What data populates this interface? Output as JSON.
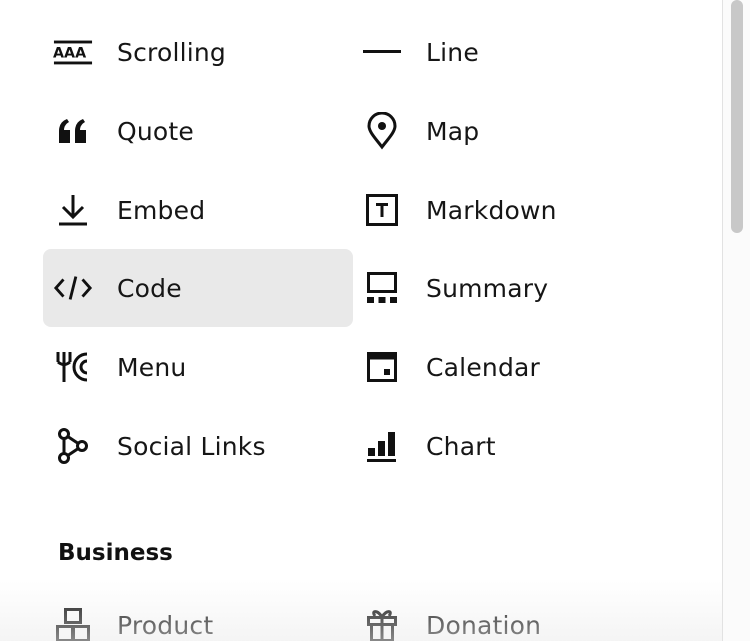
{
  "blocks": {
    "left": [
      {
        "label": "Scrolling",
        "icon": "scrolling-text-icon"
      },
      {
        "label": "Quote",
        "icon": "quote-icon"
      },
      {
        "label": "Embed",
        "icon": "embed-download-icon"
      },
      {
        "label": "Code",
        "icon": "code-icon",
        "selected": true
      },
      {
        "label": "Menu",
        "icon": "menu-fork-icon"
      },
      {
        "label": "Social Links",
        "icon": "social-links-icon"
      }
    ],
    "right": [
      {
        "label": "Line",
        "icon": "line-icon"
      },
      {
        "label": "Map",
        "icon": "map-pin-icon"
      },
      {
        "label": "Markdown",
        "icon": "markdown-icon"
      },
      {
        "label": "Summary",
        "icon": "summary-icon"
      },
      {
        "label": "Calendar",
        "icon": "calendar-icon"
      },
      {
        "label": "Chart",
        "icon": "chart-icon"
      }
    ]
  },
  "business": {
    "title": "Business",
    "items": [
      {
        "label": "Product",
        "icon": "product-boxes-icon"
      },
      {
        "label": "Donation",
        "icon": "donation-gift-icon"
      }
    ]
  },
  "colors": {
    "selected_background": "#e9e9e9",
    "text": "#111111",
    "scrollbar_thumb": "#c8c8c8"
  }
}
